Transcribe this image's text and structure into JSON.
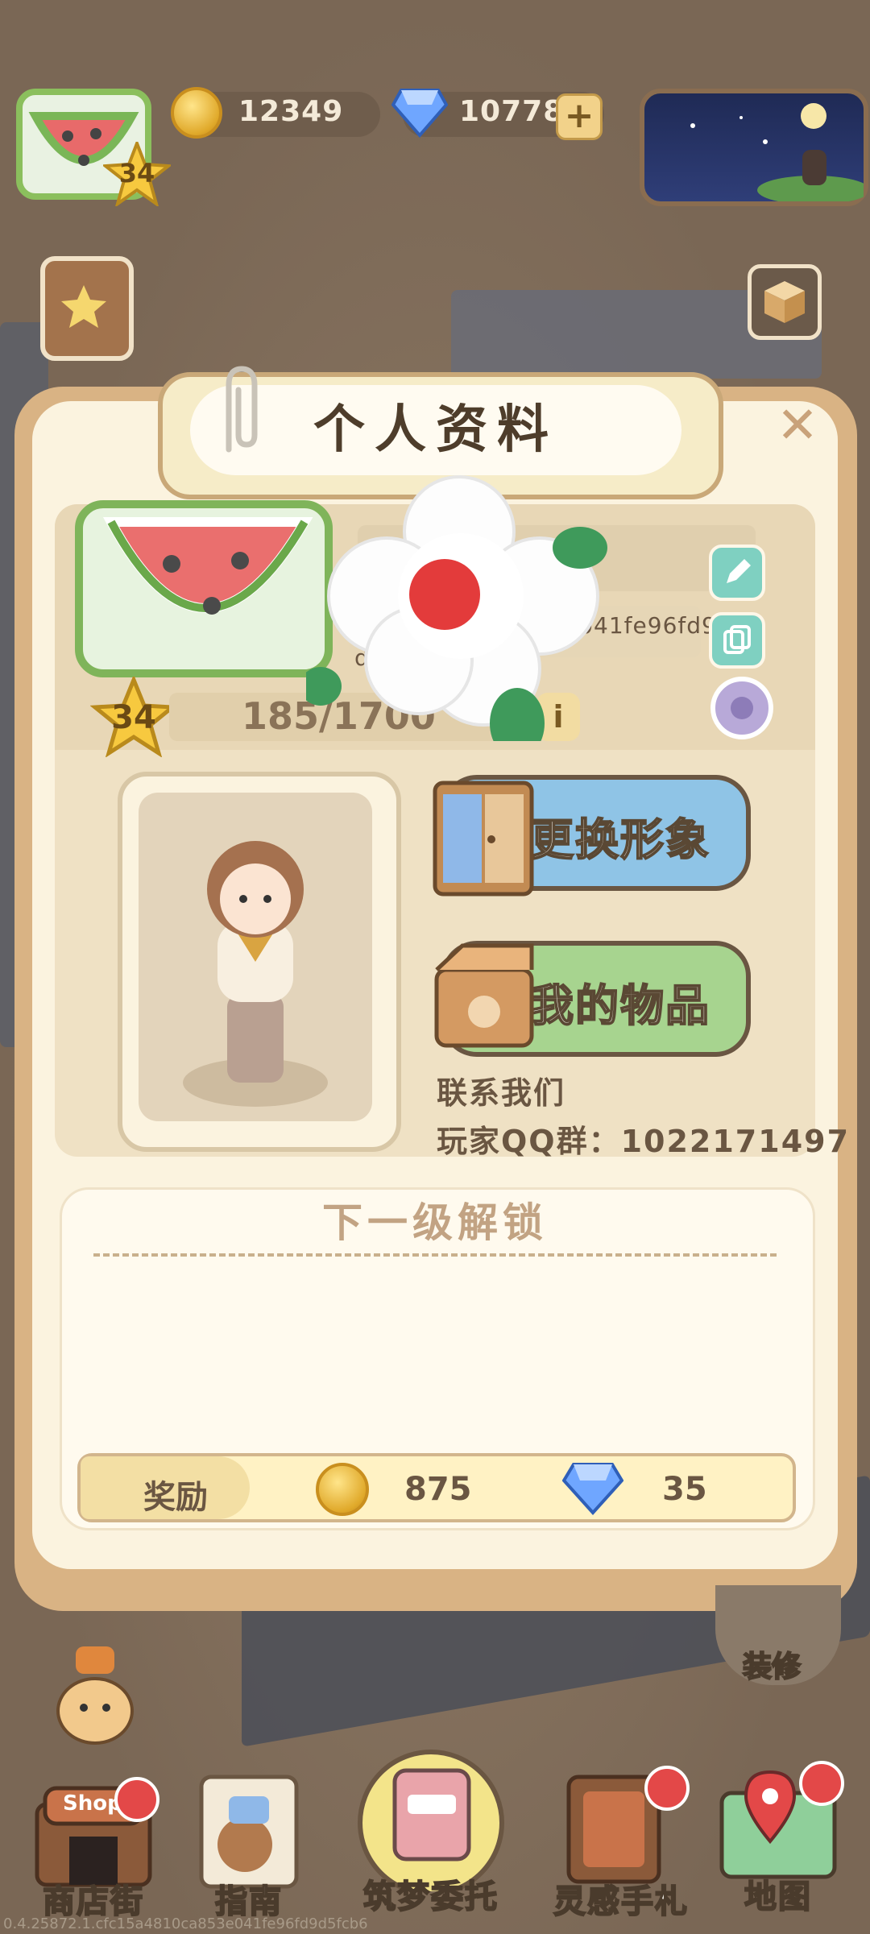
{
  "hud": {
    "level": "34",
    "coins": "12349",
    "gems": "10778",
    "add_symbol": "+"
  },
  "panel": {
    "title": "个人资料",
    "close_symbol": "✕",
    "profile": {
      "level": "34",
      "exp_progress": "185/1700",
      "id_visible_part": "e041fe96fd9",
      "id_prefix_visible": "d",
      "info_symbol": "i"
    },
    "buttons": {
      "change_look": "更换形象",
      "my_items": "我的物品"
    },
    "contact": {
      "heading": "联系我们",
      "qq_group": "玩家QQ群：1022171497"
    },
    "unlock": {
      "title": "下一级解锁",
      "reward_label": "奖励",
      "reward_coins": "875",
      "reward_gems": "35"
    }
  },
  "side": {
    "decorate_label": "装修"
  },
  "bottom_nav": [
    {
      "label": "商店街",
      "sign": "Shop",
      "badge": true
    },
    {
      "label": "指南",
      "badge": false
    },
    {
      "label": "筑梦委托",
      "badge": false
    },
    {
      "label": "灵感手札",
      "badge": true
    },
    {
      "label": "地图",
      "badge": true
    }
  ],
  "footer_watermark": "0.4.25872.1.cfc15a4810ca853e041fe96fd9d5fcb6",
  "colors": {
    "panel_bg": "#fbf3df",
    "change_look_btn": "#8fc4e6",
    "my_items_btn": "#a7d48f",
    "badge_red": "#e34848"
  }
}
